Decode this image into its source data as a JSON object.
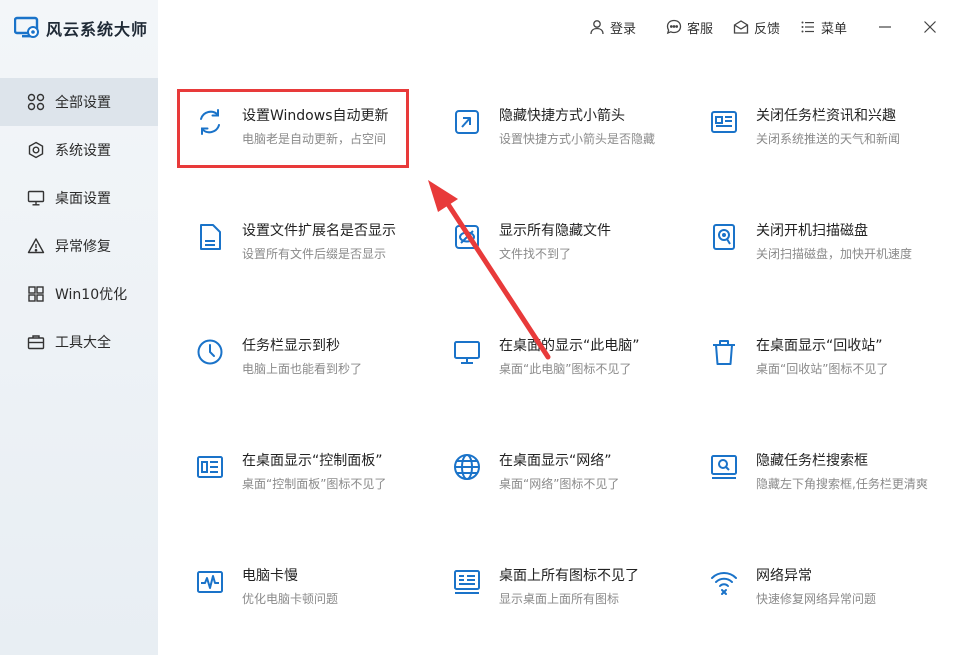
{
  "app": {
    "title": "风云系统大师"
  },
  "toolbar": {
    "login": "登录",
    "service": "客服",
    "feedback": "反馈",
    "menu": "菜单"
  },
  "sidebar": {
    "items": [
      {
        "label": "全部设置",
        "icon": "grid-icon",
        "active": true
      },
      {
        "label": "系统设置",
        "icon": "gear-icon",
        "active": false
      },
      {
        "label": "桌面设置",
        "icon": "monitor-icon",
        "active": false
      },
      {
        "label": "异常修复",
        "icon": "warning-icon",
        "active": false
      },
      {
        "label": "Win10优化",
        "icon": "windows-icon",
        "active": false
      },
      {
        "label": "工具大全",
        "icon": "toolbox-icon",
        "active": false
      }
    ]
  },
  "cards": [
    {
      "title": "设置Windows自动更新",
      "desc": "电脑老是自动更新，占空间",
      "icon": "refresh-icon"
    },
    {
      "title": "隐藏快捷方式小箭头",
      "desc": "设置快捷方式小箭头是否隐藏",
      "icon": "shortcut-arrow-icon"
    },
    {
      "title": "关闭任务栏资讯和兴趣",
      "desc": "关闭系统推送的天气和新闻",
      "icon": "news-icon"
    },
    {
      "title": "设置文件扩展名是否显示",
      "desc": "设置所有文件后缀是否显示",
      "icon": "file-icon"
    },
    {
      "title": "显示所有隐藏文件",
      "desc": "文件找不到了",
      "icon": "eye-hidden-icon"
    },
    {
      "title": "关闭开机扫描磁盘",
      "desc": "关闭扫描磁盘，加快开机速度",
      "icon": "disk-scan-icon"
    },
    {
      "title": "任务栏显示到秒",
      "desc": "电脑上面也能看到秒了",
      "icon": "clock-icon"
    },
    {
      "title": "在桌面的显示“此电脑”",
      "desc": "桌面“此电脑”图标不见了",
      "icon": "computer-icon"
    },
    {
      "title": "在桌面显示“回收站”",
      "desc": "桌面“回收站”图标不见了",
      "icon": "trash-icon"
    },
    {
      "title": "在桌面显示“控制面板”",
      "desc": "桌面“控制面板”图标不见了",
      "icon": "control-panel-icon"
    },
    {
      "title": "在桌面显示“网络”",
      "desc": "桌面“网络”图标不见了",
      "icon": "globe-icon"
    },
    {
      "title": "隐藏任务栏搜索框",
      "desc": "隐藏左下角搜索框,任务栏更清爽",
      "icon": "search-box-icon"
    },
    {
      "title": "电脑卡慢",
      "desc": "优化电脑卡顿问题",
      "icon": "pulse-icon"
    },
    {
      "title": "桌面上所有图标不见了",
      "desc": "显示桌面上面所有图标",
      "icon": "desktop-icons-icon"
    },
    {
      "title": "网络异常",
      "desc": "快速修复网络异常问题",
      "icon": "wifi-error-icon"
    }
  ],
  "colors": {
    "accent": "#1a73c9",
    "highlight": "#e83a3a",
    "sidebar_bg": "#eef2f6"
  }
}
